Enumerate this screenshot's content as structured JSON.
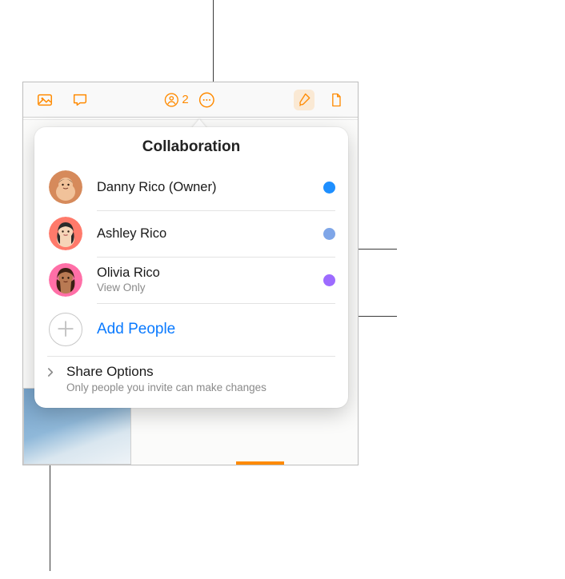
{
  "toolbar": {
    "collab_count": "2"
  },
  "popover": {
    "title": "Collaboration",
    "add_label": "Add People",
    "share": {
      "title": "Share Options",
      "subtitle": "Only people you invite can make changes"
    }
  },
  "participants": [
    {
      "name": "Danny Rico (Owner)",
      "subtitle": "",
      "dot_color": "#1e8fff",
      "avatar_bg": "#d68a5b",
      "avatar_skin": "#f1c29a",
      "avatar_hair": "#3a2a1c"
    },
    {
      "name": "Ashley Rico",
      "subtitle": "",
      "dot_color": "#7fa6e8",
      "avatar_bg": "#ff7a6b",
      "avatar_skin": "#f6d5b8",
      "avatar_hair": "#2b2b2b"
    },
    {
      "name": "Olivia Rico",
      "subtitle": "View Only",
      "dot_color": "#9d6bff",
      "avatar_bg": "#ff6fa7",
      "avatar_skin": "#b97a53",
      "avatar_hair": "#3a1f12"
    }
  ]
}
